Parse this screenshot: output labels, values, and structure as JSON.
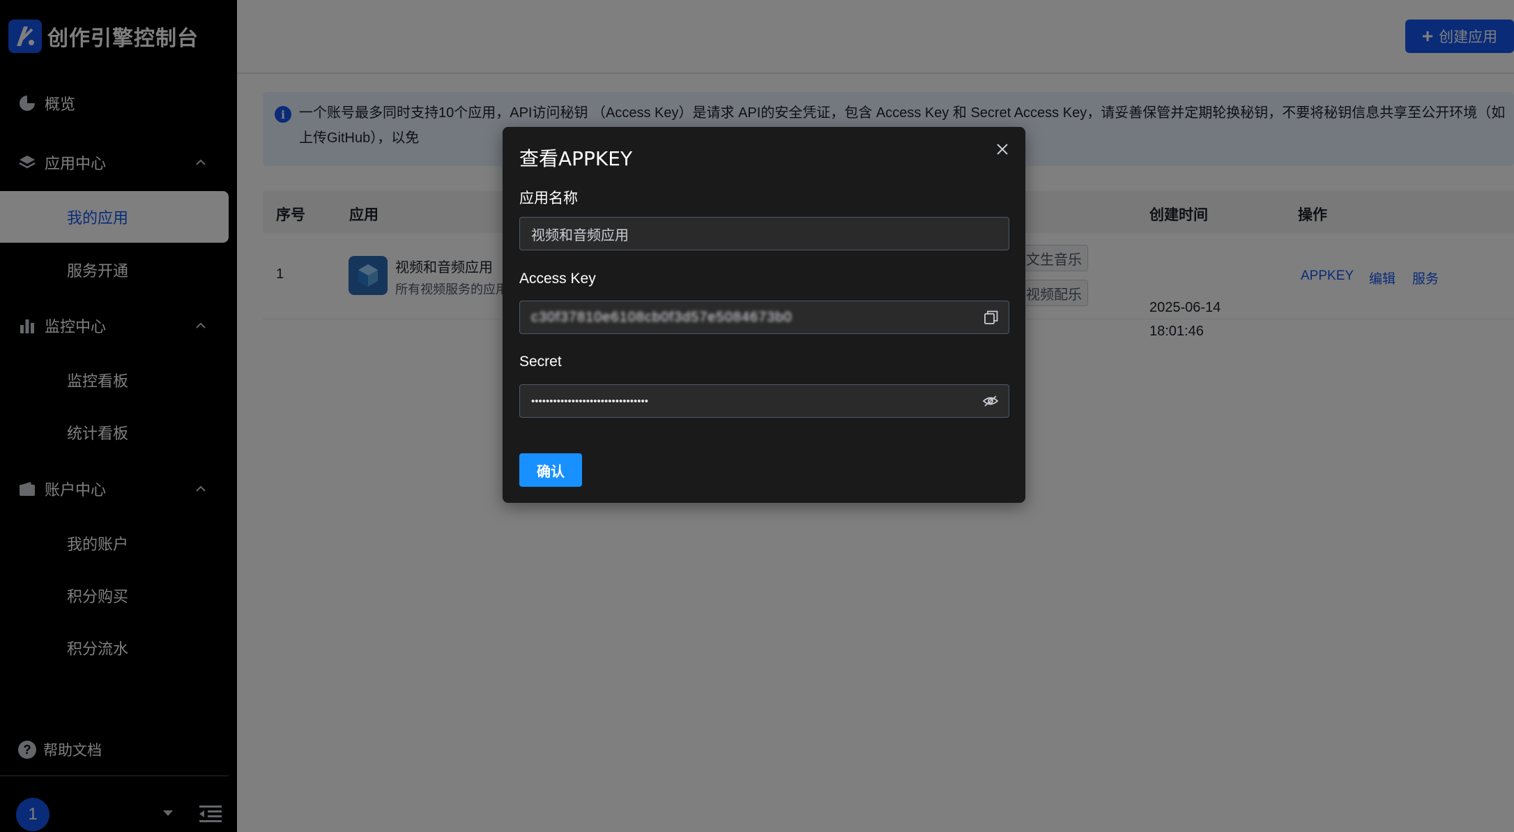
{
  "brand": {
    "name": "创作引擎控制台"
  },
  "sidebar": {
    "groups": [
      {
        "label": "概览",
        "icon": "pie-chart-icon"
      },
      {
        "label": "应用中心",
        "icon": "stack-icon",
        "items": [
          {
            "label": "我的应用",
            "active": true
          },
          {
            "label": "服务开通"
          }
        ]
      },
      {
        "label": "监控中心",
        "icon": "bar-chart-icon",
        "items": [
          {
            "label": "监控看板"
          },
          {
            "label": "统计看板"
          }
        ]
      },
      {
        "label": "账户中心",
        "icon": "wallet-icon",
        "items": [
          {
            "label": "我的账户"
          },
          {
            "label": "积分购买"
          },
          {
            "label": "积分流水"
          }
        ]
      }
    ],
    "help": "帮助文档",
    "user_avatar": "1"
  },
  "header": {
    "create_button": "创建应用"
  },
  "alert": {
    "text": "一个账号最多同时支持10个应用，API访问秘钥 （Access Key）是请求 API的安全凭证，包含 Access Key 和 Secret Access Key，请妥善保管并定期轮换秘钥，不要将秘钥信息共享至公开环境（如上传GitHub），以免"
  },
  "table": {
    "columns": {
      "index": "序号",
      "app": "应用",
      "created": "创建时间",
      "actions": "操作"
    },
    "rows": [
      {
        "index": "1",
        "app_name": "视频和音频应用",
        "app_desc": "所有视频服务的应用",
        "tags": [
          "文生音乐",
          "视频配乐"
        ],
        "date": "2025-06-14",
        "time": "18:01:46",
        "actions": [
          "APPKEY",
          "编辑",
          "服务"
        ]
      }
    ]
  },
  "modal": {
    "title": "查看APPKEY",
    "app_name_label": "应用名称",
    "app_name_value": "视频和音频应用",
    "access_key_label": "Access Key",
    "access_key_value": "c30f37810e6108cb0f3d57e5084673b0",
    "secret_label": "Secret",
    "secret_value": "••••••••••••••••••••••••••••••••",
    "confirm": "确认"
  },
  "colors": {
    "accent": "#1456f0",
    "confirm": "#1890ff",
    "sidebar_bg": "#000000",
    "modal_bg": "#1a1a1a"
  }
}
